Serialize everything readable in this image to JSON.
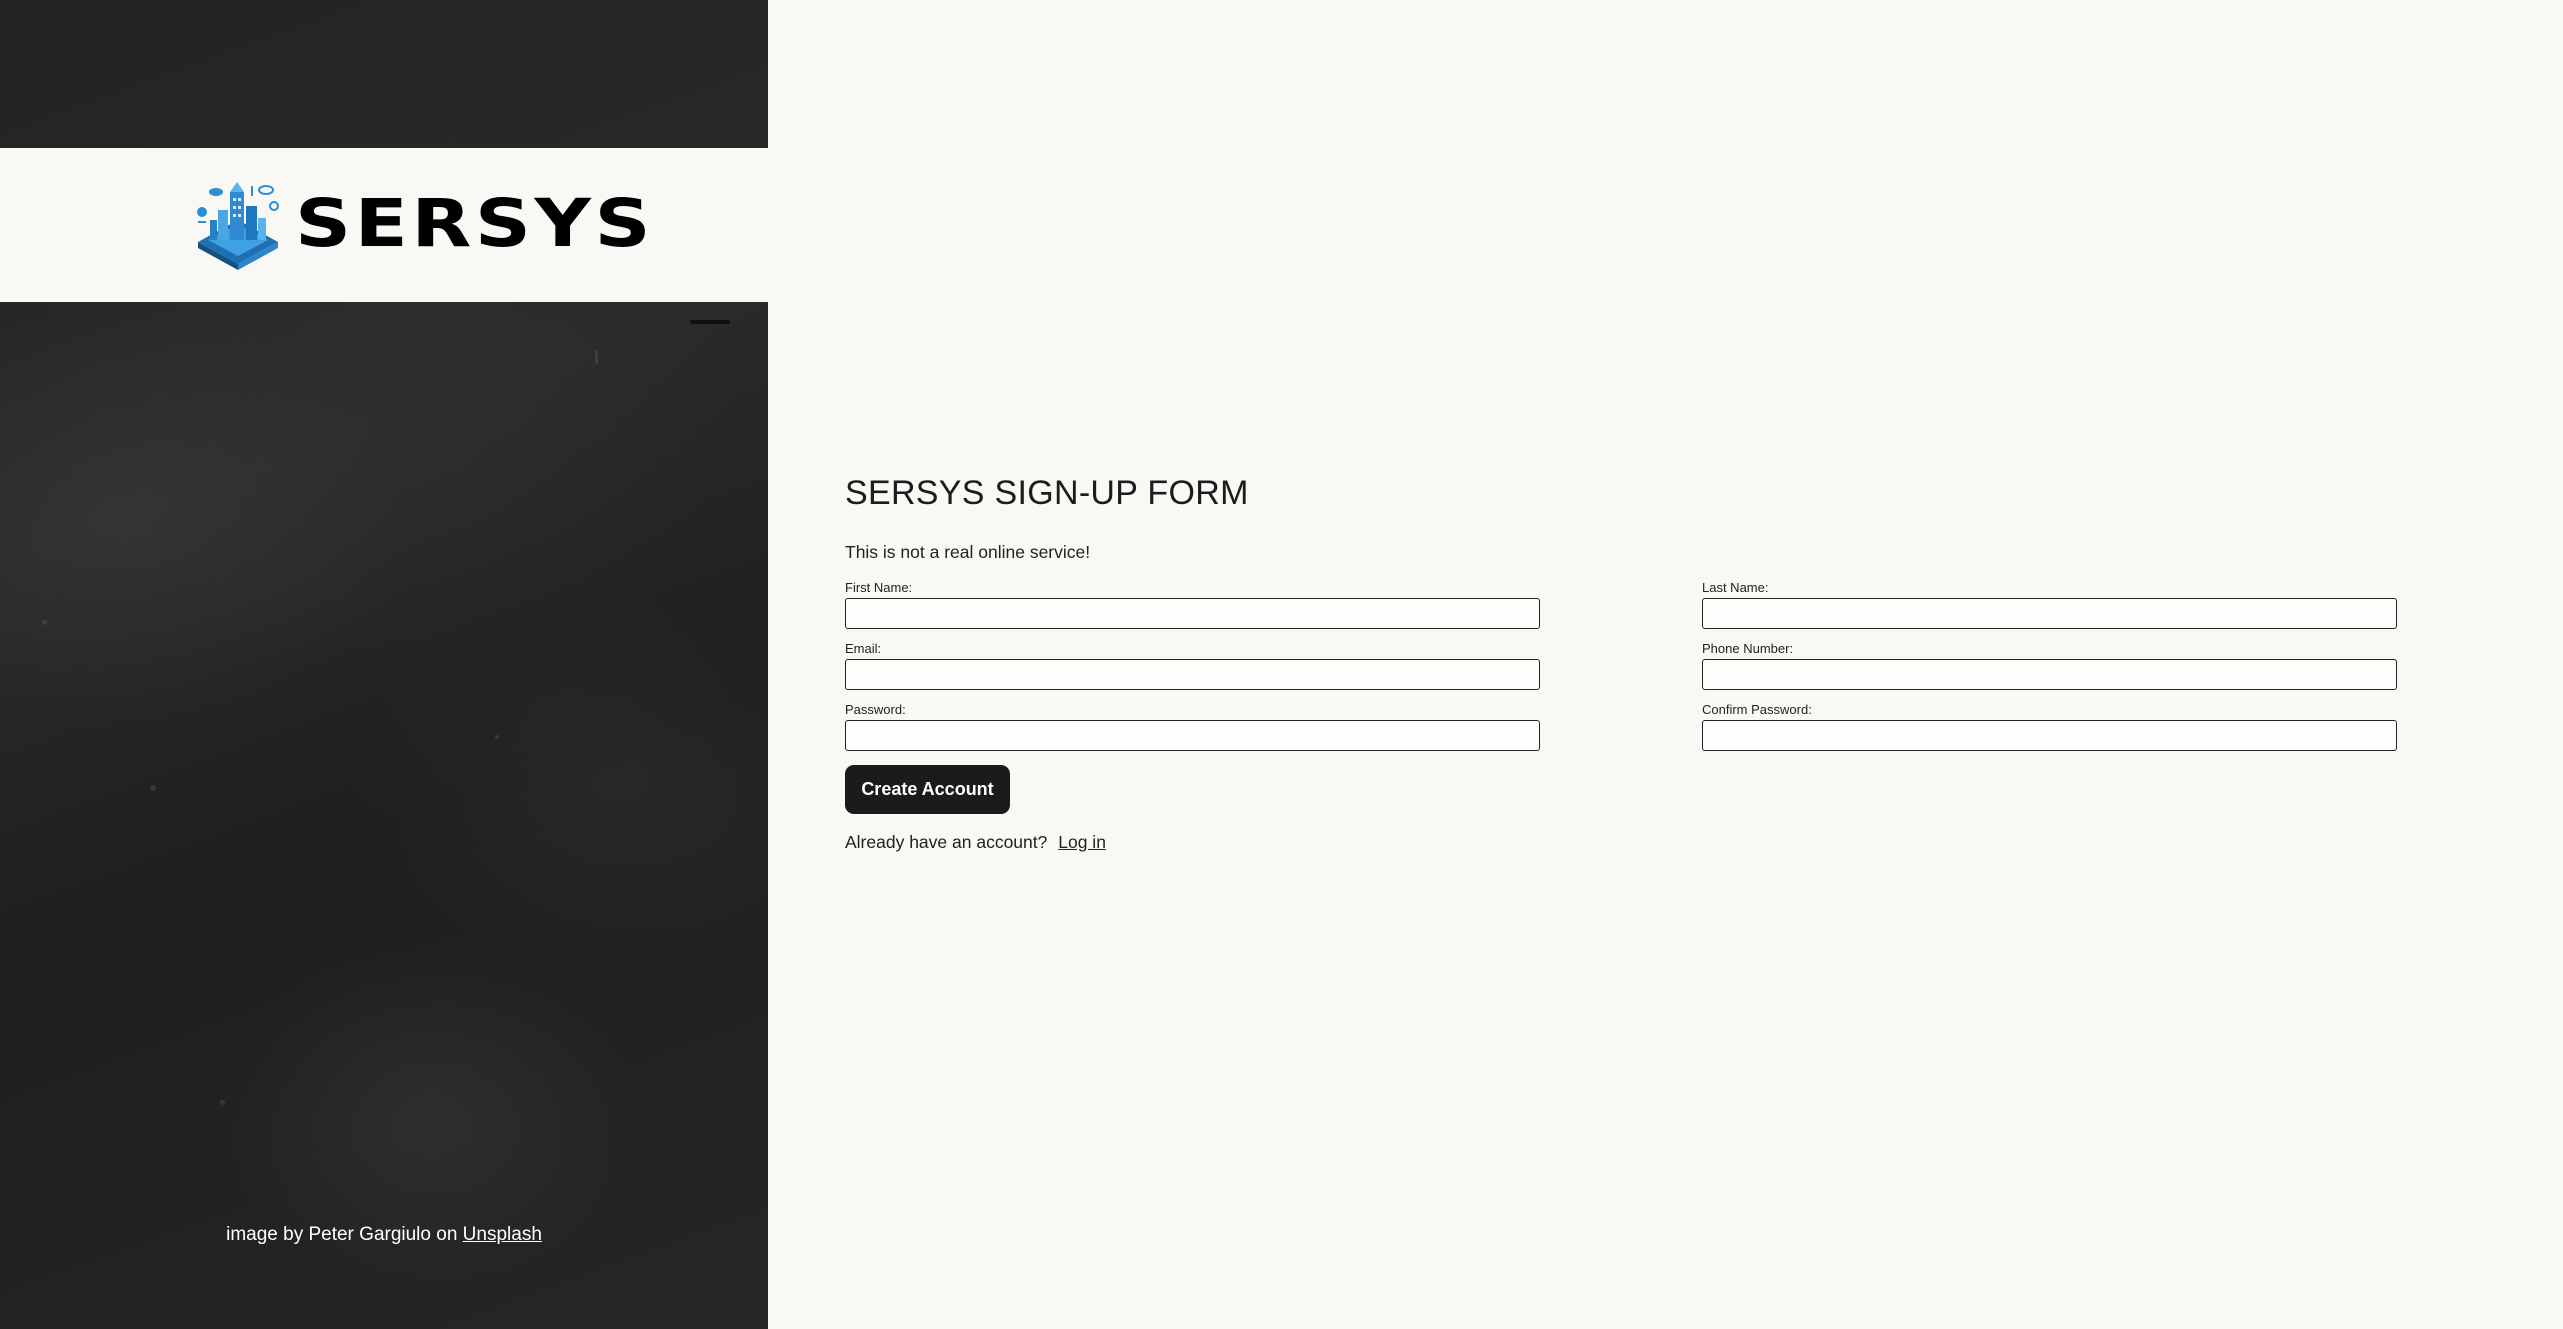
{
  "brand": {
    "name": "SERSYS",
    "logo_icon": "isometric-city-icon",
    "accent_color": "#2a8fd6"
  },
  "sidebar": {
    "credit_prefix": "image by Peter Gargiulo on",
    "credit_link": "Unsplash"
  },
  "form": {
    "title": "SERSYS SIGN-UP FORM",
    "note": "This is not a real online service!",
    "fields": {
      "first_name": {
        "label": "First Name:",
        "value": ""
      },
      "last_name": {
        "label": "Last Name:",
        "value": ""
      },
      "email": {
        "label": "Email:",
        "value": ""
      },
      "phone": {
        "label": "Phone Number:",
        "value": ""
      },
      "password": {
        "label": "Password:",
        "value": ""
      },
      "confirm_password": {
        "label": "Confirm Password:",
        "value": ""
      }
    },
    "submit_label": "Create Account",
    "login_prompt": "Already have an account?",
    "login_link": "Log in"
  },
  "colors": {
    "page_background": "#f9f8f4",
    "sidebar_background": "#232323",
    "button_background": "#1b1b1b",
    "button_text": "#ffffff"
  }
}
